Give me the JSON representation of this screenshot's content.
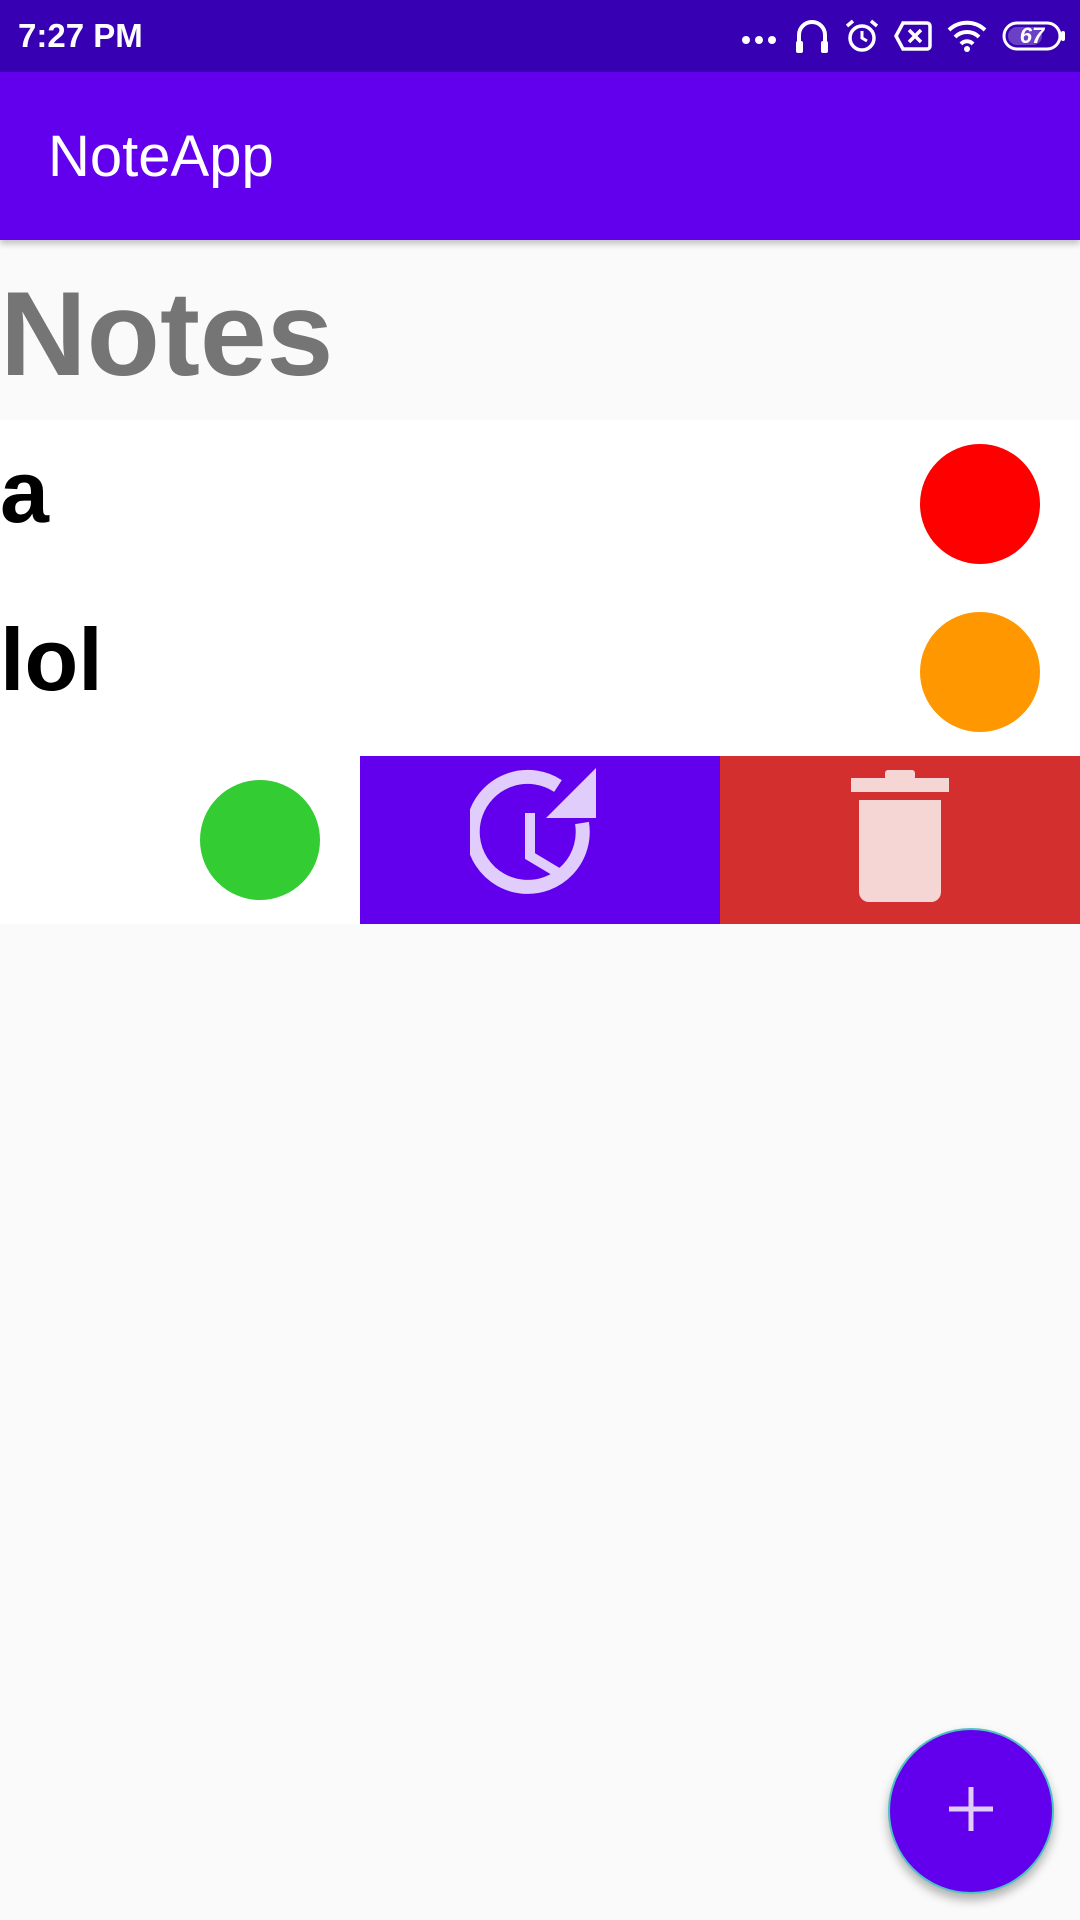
{
  "status_bar": {
    "time": "7:27 PM",
    "icons": [
      "more-dots-icon",
      "headphones-icon",
      "alarm-icon",
      "no-sim-icon",
      "wifi-icon",
      "battery-icon"
    ],
    "battery_level": "67"
  },
  "app_bar": {
    "title": "NoteApp",
    "color": "#6200ee"
  },
  "main": {
    "heading": "Notes",
    "notes": [
      {
        "title": "a",
        "color": "#ff0000"
      },
      {
        "title": "lol",
        "color": "#ff9800"
      },
      {
        "title": "",
        "color": "#33cc33",
        "swiped": true
      }
    ],
    "swipe_actions": [
      {
        "name": "reschedule",
        "icon": "history-clock-icon",
        "color": "#6200ee"
      },
      {
        "name": "delete",
        "icon": "trash-icon",
        "color": "#d32f2f"
      }
    ]
  },
  "fab": {
    "label": "+",
    "icon": "plus-icon"
  },
  "colors": {
    "status_bar": "#3700b3",
    "primary": "#6200ee",
    "background": "#fafafa",
    "heading_text": "#757575"
  }
}
